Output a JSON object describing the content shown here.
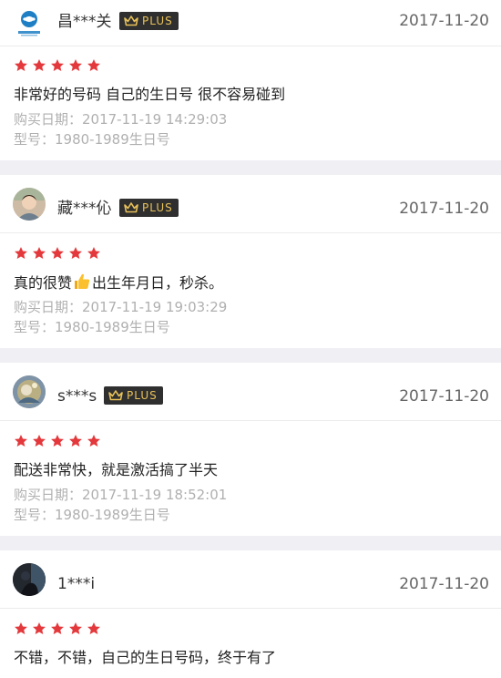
{
  "colors": {
    "star": "#e4393c",
    "plus_gold": "#e8c15a",
    "plus_bg": "#2f2f2f",
    "muted_text": "#b0b0b0",
    "separator": "#efeff4"
  },
  "reviews": [
    {
      "username": "昌***关",
      "plus_label": "PLUS",
      "date": "2017-11-20",
      "rating": 5,
      "avatar_icon": "china-mobile-logo-avatar",
      "comment": "非常好的号码 自己的生日号 很不容易碰到",
      "purchase_date": "购买日期：2017-11-19 14:29:03",
      "model": "型号：1980-1989生日号"
    },
    {
      "username": "藏***伈",
      "plus_label": "PLUS",
      "date": "2017-11-20",
      "rating": 5,
      "avatar_icon": "person-photo-avatar",
      "comment_before": "真的很赞",
      "comment_after": "出生年月日，秒杀。",
      "purchase_date": "购买日期：2017-11-19 19:03:29",
      "model": "型号：1980-1989生日号"
    },
    {
      "username": "s***s",
      "plus_label": "PLUS",
      "date": "2017-11-20",
      "rating": 5,
      "avatar_icon": "anime-art-avatar",
      "comment": "配送非常快，就是激活搞了半天",
      "purchase_date": "购买日期：2017-11-19 18:52:01",
      "model": "型号：1980-1989生日号"
    },
    {
      "username": "1***i",
      "date": "2017-11-20",
      "rating": 5,
      "avatar_icon": "dark-photo-avatar",
      "comment": "不错，不错，自己的生日号码，终于有了"
    }
  ]
}
